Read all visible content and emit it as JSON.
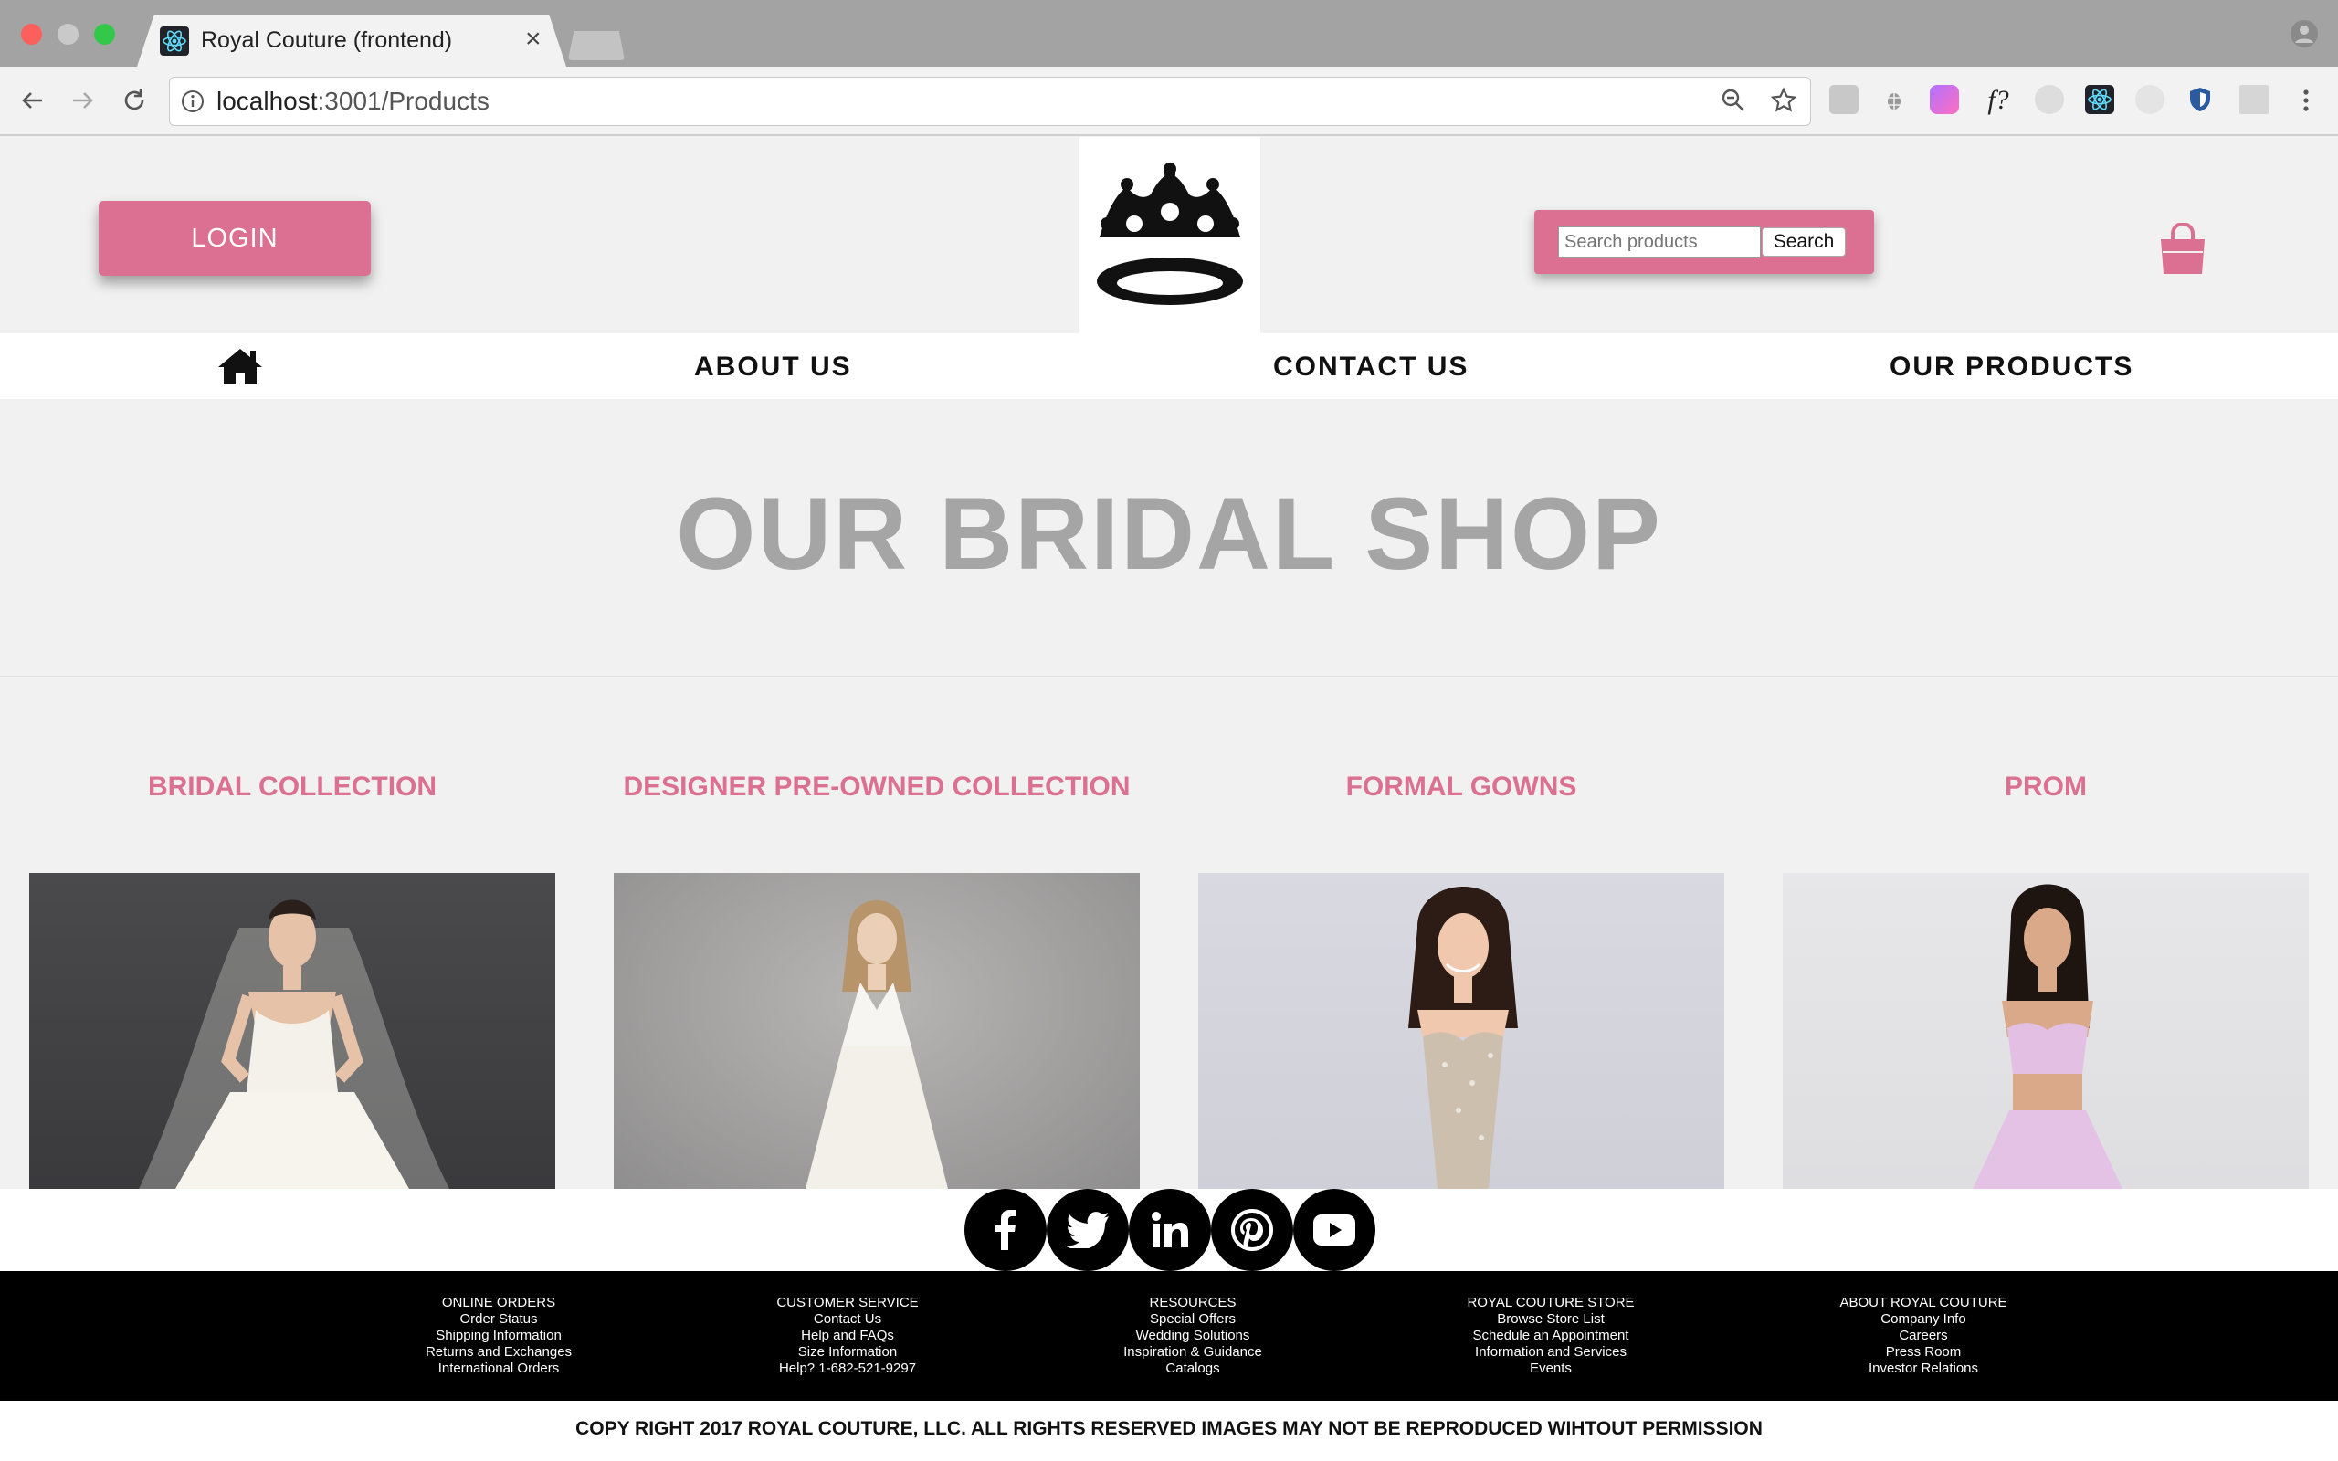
{
  "browser": {
    "tab_title": "Royal Couture (frontend)",
    "url_host": "localhost",
    "url_path": ":3001/Products"
  },
  "header": {
    "login_label": "LOGIN",
    "search_placeholder": "Search products",
    "search_button": "Search"
  },
  "nav": {
    "items": [
      "ABOUT US",
      "CONTACT US",
      "OUR PRODUCTS"
    ]
  },
  "hero": {
    "title": "OUR BRIDAL SHOP"
  },
  "categories": [
    {
      "title": "BRIDAL COLLECTION"
    },
    {
      "title": "DESIGNER PRE-OWNED COLLECTION"
    },
    {
      "title": "FORMAL GOWNS"
    },
    {
      "title": "PROM"
    }
  ],
  "social": [
    "facebook-icon",
    "twitter-icon",
    "linkedin-icon",
    "pinterest-icon",
    "youtube-icon"
  ],
  "footer": {
    "columns": [
      {
        "heading": "ONLINE ORDERS",
        "links": [
          "Order Status",
          "Shipping Information",
          "Returns and Exchanges",
          "International Orders"
        ]
      },
      {
        "heading": "CUSTOMER SERVICE",
        "links": [
          "Contact Us",
          "Help and FAQs",
          "Size Information",
          "Help? 1-682-521-9297"
        ]
      },
      {
        "heading": "RESOURCES",
        "links": [
          "Special Offers",
          "Wedding Solutions",
          "Inspiration & Guidance",
          "Catalogs"
        ]
      },
      {
        "heading": "ROYAL COUTURE STORE",
        "links": [
          "Browse Store List",
          "Schedule an Appointment",
          "Information and Services",
          "Events"
        ]
      },
      {
        "heading": "ABOUT ROYAL COUTURE",
        "links": [
          "Company Info",
          "Careers",
          "Press Room",
          "Investor Relations"
        ]
      }
    ],
    "copyright": "COPY RIGHT 2017 ROYAL COUTURE, LLC. ALL RIGHTS RESERVED IMAGES MAY NOT BE REPRODUCED WIHTOUT PERMISSION"
  },
  "colors": {
    "accent": "#db7093",
    "footer_bg": "#000000",
    "hero_text": "#a5a5a5"
  }
}
